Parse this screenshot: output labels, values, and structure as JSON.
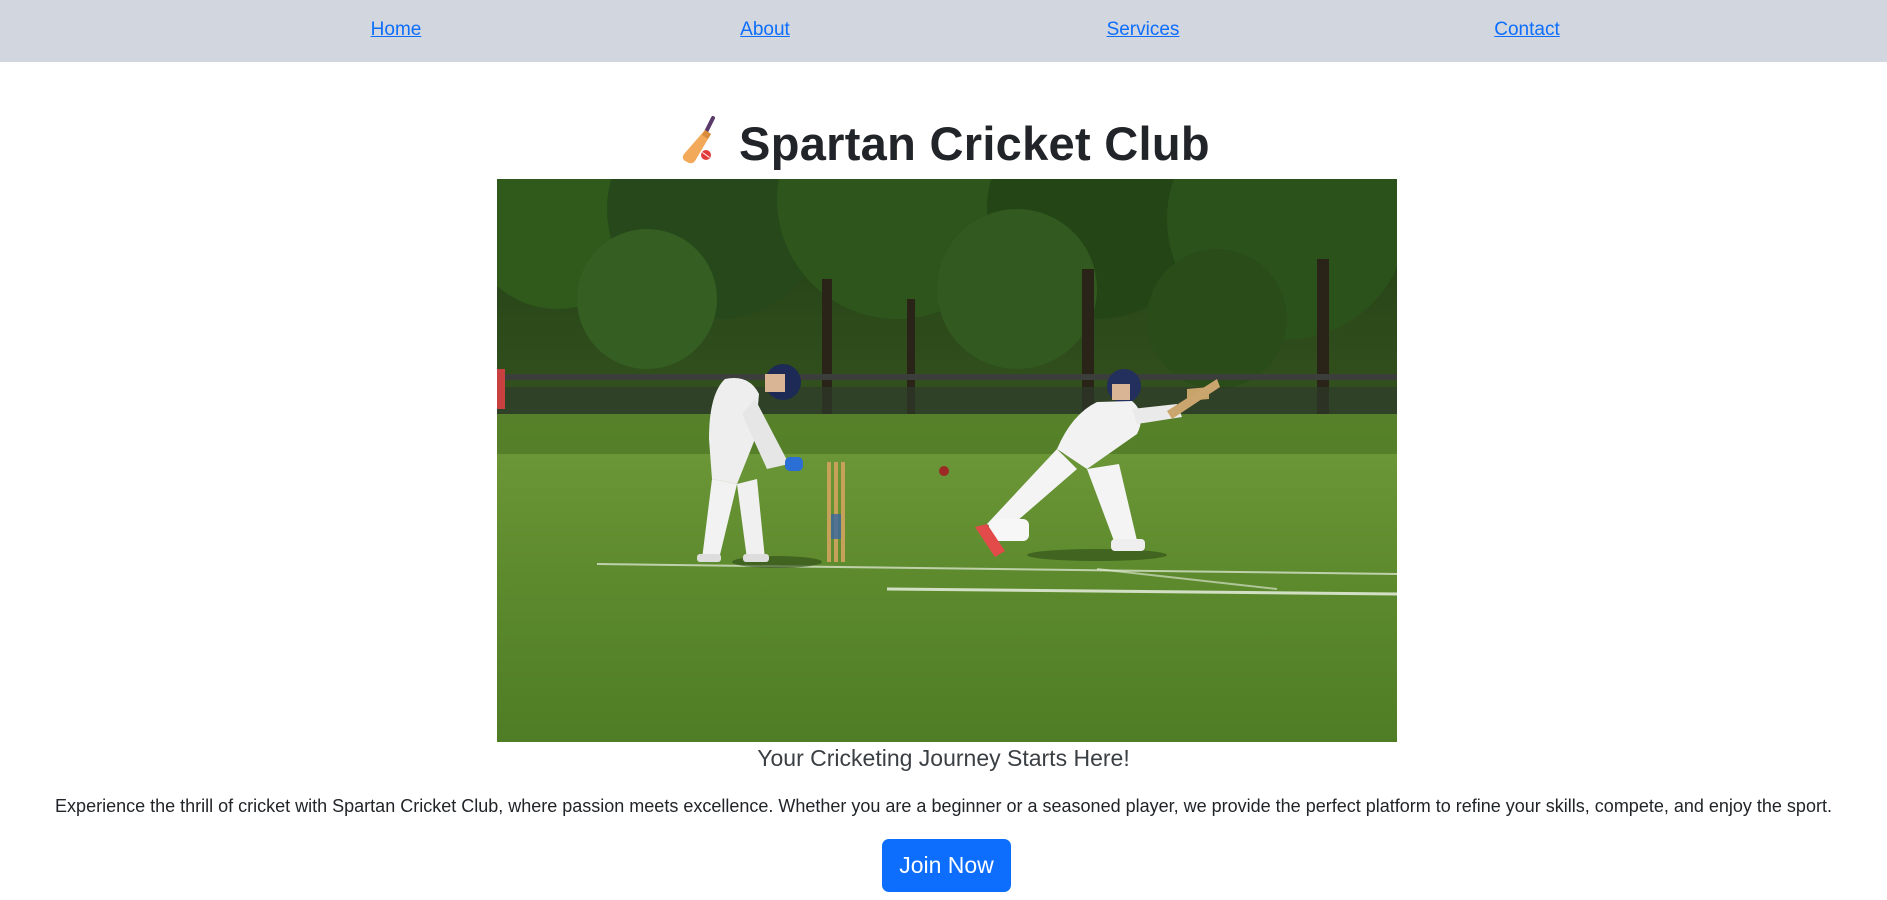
{
  "nav": {
    "items": [
      {
        "label": "Home"
      },
      {
        "label": "About"
      },
      {
        "label": "Services"
      },
      {
        "label": "Contact"
      }
    ]
  },
  "hero": {
    "title": "Spartan Cricket Club",
    "title_icon": "cricket-bat-icon",
    "photo_subject": "cricket-match-photo",
    "tagline": "Your Cricketing Journey Starts Here!",
    "description": "Experience the thrill of cricket with Spartan Cricket Club, where passion meets excellence. Whether you are a beginner or a seasoned player, we provide the perfect platform to refine your skills, compete, and enjoy the sport.",
    "cta_label": "Join Now"
  },
  "colors": {
    "nav_background": "#d1d6df",
    "link": "#0d6efd",
    "button": "#0d6efd",
    "button_text": "#ffffff",
    "heading": "#212529"
  }
}
